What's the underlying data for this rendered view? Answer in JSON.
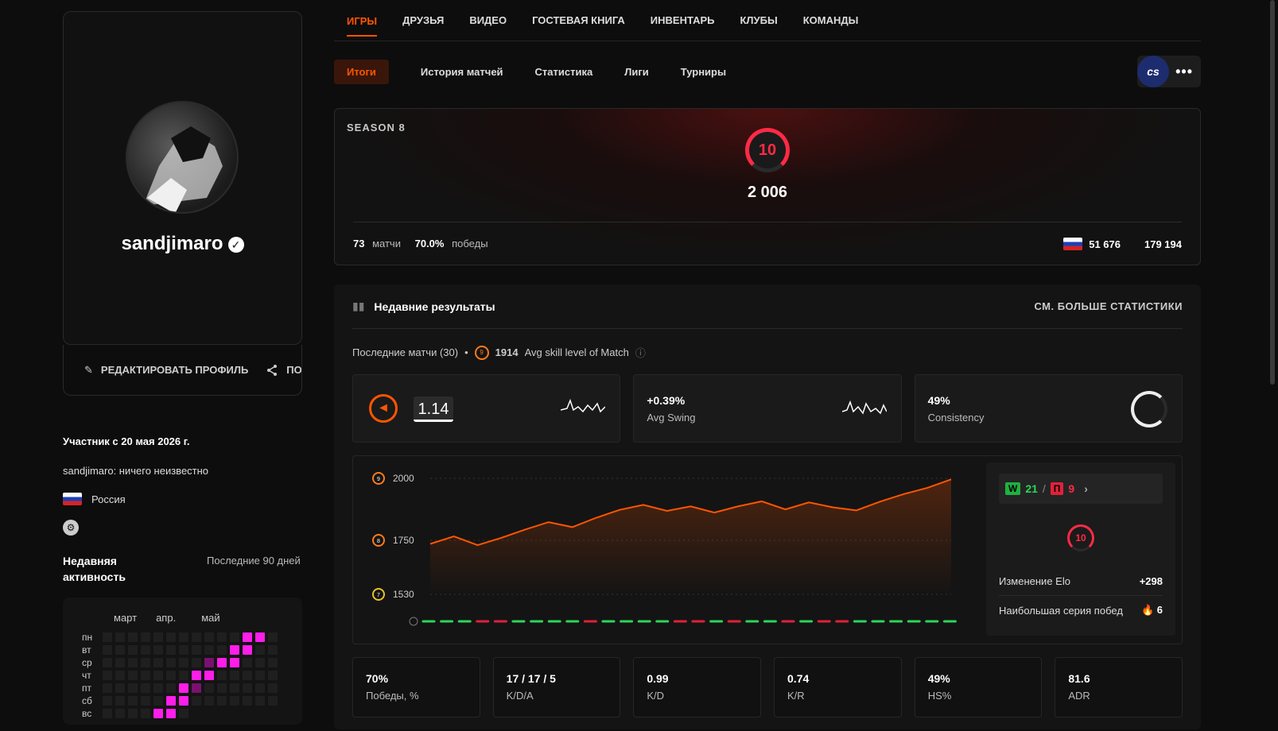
{
  "profile": {
    "username": "sandjimaro",
    "edit_label": "РЕДАКТИРОВАТЬ ПРОФИЛЬ",
    "share_label": "ПОД",
    "member_since": "Участник с 20 мая 2026 г.",
    "bio": "sandjimaro: ничего неизвестно",
    "country": "Россия",
    "activity_title": "Недавняя активность",
    "activity_range": "Последние 90 дней",
    "months": [
      "март",
      "апр.",
      "май"
    ],
    "days": [
      "пн",
      "вт",
      "ср",
      "чт",
      "пт",
      "сб",
      "вс"
    ]
  },
  "top_nav": [
    "ИГРЫ",
    "ДРУЗЬЯ",
    "ВИДЕО",
    "ГОСТЕВАЯ КНИГА",
    "ИНВЕНТАРЬ",
    "КЛУБЫ",
    "КОМАНДЫ"
  ],
  "sub_nav": [
    "Итоги",
    "История матчей",
    "Статистика",
    "Лиги",
    "Турниры"
  ],
  "game_badge": "cs",
  "season": {
    "label": "SEASON 8",
    "level": "10",
    "elo": "2 006",
    "matches": "73",
    "matches_label": "матчи",
    "winrate": "70.0%",
    "winrate_label": "победы",
    "country_rank": "51 676",
    "world_rank": "179 194"
  },
  "recent": {
    "title": "Недавние результаты",
    "see_more": "СМ. БОЛЬШЕ СТАТИСТИКИ",
    "last_matches": "Последние матчи (30)",
    "avg_skill_value": "1914",
    "avg_skill_label": "Avg skill level of Match",
    "avg_skill_level_icon": "9",
    "rating": "1.14",
    "swing_value": "+0.39%",
    "swing_label": "Avg Swing",
    "consistency_value": "49%",
    "consistency_label": "Consistency"
  },
  "chart_data": {
    "type": "line",
    "title": "",
    "ylabels": [
      {
        "value": 2000,
        "level": "9"
      },
      {
        "value": 1750,
        "level": "8"
      },
      {
        "value": 1530,
        "level": "7"
      }
    ],
    "ylim": [
      1530,
      2000
    ],
    "values": [
      1738,
      1768,
      1733,
      1762,
      1795,
      1825,
      1805,
      1842,
      1874,
      1894,
      1870,
      1888,
      1863,
      1888,
      1908,
      1876,
      1904,
      1884,
      1872,
      1907,
      1937,
      1962,
      1996
    ],
    "results": [
      "W",
      "W",
      "W",
      "L",
      "L",
      "W",
      "W",
      "W",
      "W",
      "L",
      "W",
      "W",
      "W",
      "W",
      "L",
      "L",
      "W",
      "L",
      "W",
      "W",
      "L",
      "W",
      "L",
      "L",
      "W",
      "W",
      "W",
      "W",
      "W",
      "W"
    ]
  },
  "side": {
    "wins_badge": "W",
    "wins": "21",
    "sep": "/",
    "loss_badge": "П",
    "losses": "9",
    "level": "10",
    "elo_change_label": "Изменение Elo",
    "elo_change_value": "+298",
    "streak_label": "Наибольшая серия побед",
    "streak_value": "6"
  },
  "bottom_stats": [
    {
      "value": "70%",
      "label": "Победы, %"
    },
    {
      "value": "17 / 17 / 5",
      "label": "K/D/A"
    },
    {
      "value": "0.99",
      "label": "K/D"
    },
    {
      "value": "0.74",
      "label": "K/R"
    },
    {
      "value": "49%",
      "label": "HS%"
    },
    {
      "value": "81.6",
      "label": "ADR"
    }
  ],
  "colors": {
    "accent": "#ff5500",
    "level_red": "#ff2a45",
    "win": "#2bd55a",
    "loss": "#e0213a",
    "heat": "#ff1dea"
  }
}
